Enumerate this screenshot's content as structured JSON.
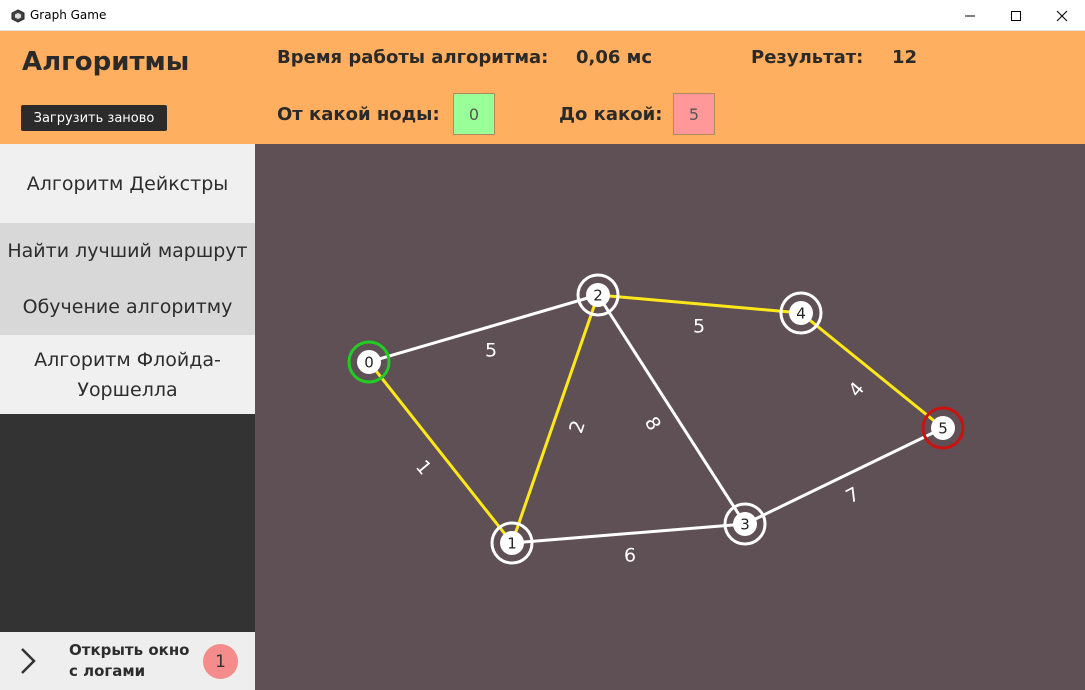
{
  "window": {
    "title": "Graph Game",
    "icon": "app-cube-icon",
    "controls": [
      "minimize-icon",
      "maximize-icon",
      "close-icon"
    ]
  },
  "header": {
    "section_title": "Алгоритмы",
    "reload_label": "Загрузить заново",
    "time_label": "Время работы алгоритма:",
    "time_value": "0,06 мс",
    "result_label": "Результат:",
    "result_value": "12",
    "from_label": "От какой ноды:",
    "from_value": "0",
    "from_color": "#99ff99",
    "to_label": "До какой:",
    "to_value": "5",
    "to_color": "#ff9999"
  },
  "sidebar": {
    "items": [
      {
        "label": "Алгоритм Дейкстры",
        "kind": "primary"
      },
      {
        "label": "Найти лучший маршрут",
        "kind": "sub"
      },
      {
        "label": "Обучение алгоритму",
        "kind": "sub"
      },
      {
        "label": "Алгоритм Флойда-Уоршелла",
        "kind": "primary"
      }
    ],
    "logs": {
      "label": "Открыть окно с логами",
      "badge": "1",
      "icon": "chevron-right-icon"
    }
  },
  "graph": {
    "colors": {
      "background": "#5e5055",
      "edge": "#ffffff",
      "path_edge": "#ffe81a",
      "start_ring": "#22cc22",
      "end_ring": "#cc1111",
      "node_ring": "#ffffff"
    },
    "nodes": [
      {
        "id": "0",
        "role": "start"
      },
      {
        "id": "1",
        "role": "normal"
      },
      {
        "id": "2",
        "role": "normal"
      },
      {
        "id": "3",
        "role": "normal"
      },
      {
        "id": "4",
        "role": "normal"
      },
      {
        "id": "5",
        "role": "end"
      }
    ],
    "edges": [
      {
        "from": "0",
        "to": "2",
        "weight": "5",
        "on_path": false
      },
      {
        "from": "0",
        "to": "1",
        "weight": "1",
        "on_path": true
      },
      {
        "from": "1",
        "to": "2",
        "weight": "2",
        "on_path": true
      },
      {
        "from": "2",
        "to": "3",
        "weight": "8",
        "on_path": false
      },
      {
        "from": "2",
        "to": "4",
        "weight": "5",
        "on_path": true
      },
      {
        "from": "4",
        "to": "5",
        "weight": "4",
        "on_path": true
      },
      {
        "from": "1",
        "to": "3",
        "weight": "6",
        "on_path": false
      },
      {
        "from": "3",
        "to": "5",
        "weight": "7",
        "on_path": false
      }
    ]
  }
}
